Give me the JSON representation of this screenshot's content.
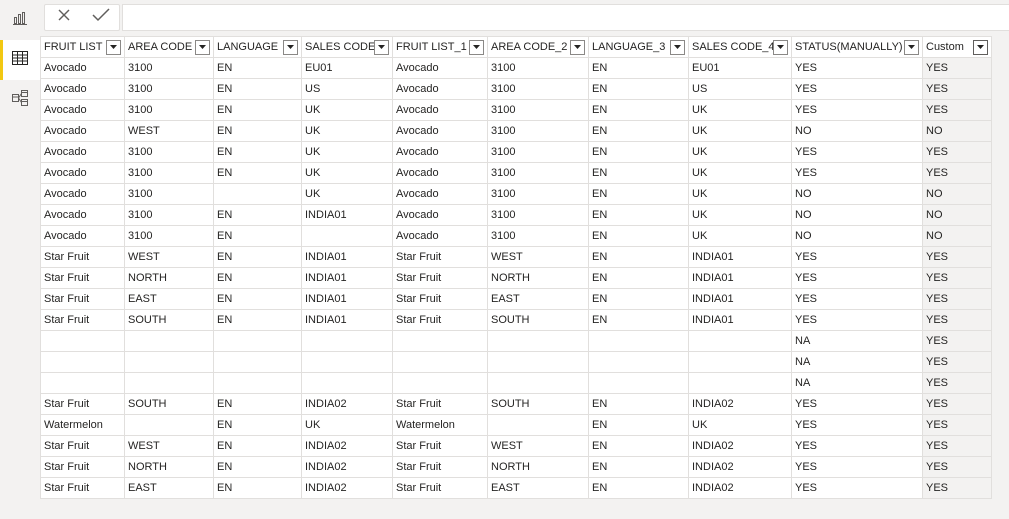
{
  "nav": {
    "items": [
      {
        "name": "report-view-button",
        "icon": "bar-chart-icon"
      },
      {
        "name": "data-view-button",
        "icon": "table-grid-icon"
      },
      {
        "name": "model-view-button",
        "icon": "model-diagram-icon"
      }
    ],
    "active_index": 1,
    "accent_color": "#f2c811"
  },
  "formula": {
    "cancel_icon": "close-icon",
    "commit_icon": "checkmark-icon",
    "value": ""
  },
  "table": {
    "columns": [
      {
        "label": "FRUIT LIST",
        "width": 84
      },
      {
        "label": "AREA CODE",
        "width": 89
      },
      {
        "label": "LANGUAGE",
        "width": 88
      },
      {
        "label": "SALES CODE",
        "width": 91
      },
      {
        "label": "FRUIT LIST_1",
        "width": 95
      },
      {
        "label": "AREA CODE_2",
        "width": 101
      },
      {
        "label": "LANGUAGE_3",
        "width": 100
      },
      {
        "label": "SALES CODE_4",
        "width": 103
      },
      {
        "label": "STATUS(MANUALLY)",
        "width": 131
      },
      {
        "label": "Custom",
        "width": 69,
        "highlight": true
      }
    ],
    "highlight_color": "#c8a227",
    "rows": [
      [
        "Avocado",
        "3100",
        "EN",
        "EU01",
        "Avocado",
        "3100",
        "EN",
        "EU01",
        "YES",
        "YES"
      ],
      [
        "Avocado",
        "3100",
        "EN",
        "US",
        "Avocado",
        "3100",
        "EN",
        "US",
        "YES",
        "YES"
      ],
      [
        "Avocado",
        "3100",
        "EN",
        "UK",
        "Avocado",
        "3100",
        "EN",
        "UK",
        "YES",
        "YES"
      ],
      [
        "Avocado",
        "WEST",
        "EN",
        "UK",
        "Avocado",
        "3100",
        "EN",
        "UK",
        "NO",
        "NO"
      ],
      [
        "Avocado",
        "3100",
        "EN",
        "UK",
        "Avocado",
        "3100",
        "EN",
        "UK",
        "YES",
        "YES"
      ],
      [
        "Avocado",
        "3100",
        "EN",
        "UK",
        "Avocado",
        "3100",
        "EN",
        "UK",
        "YES",
        "YES"
      ],
      [
        "Avocado",
        "3100",
        "",
        "UK",
        "Avocado",
        "3100",
        "EN",
        "UK",
        "NO",
        "NO"
      ],
      [
        "Avocado",
        "3100",
        "EN",
        "INDIA01",
        "Avocado",
        "3100",
        "EN",
        "UK",
        "NO",
        "NO"
      ],
      [
        "Avocado",
        "3100",
        "EN",
        "",
        "Avocado",
        "3100",
        "EN",
        "UK",
        "NO",
        "NO"
      ],
      [
        "Star Fruit",
        "WEST",
        "EN",
        "INDIA01",
        "Star Fruit",
        "WEST",
        "EN",
        "INDIA01",
        "YES",
        "YES"
      ],
      [
        "Star Fruit",
        "NORTH",
        "EN",
        "INDIA01",
        "Star Fruit",
        "NORTH",
        "EN",
        "INDIA01",
        "YES",
        "YES"
      ],
      [
        "Star Fruit",
        "EAST",
        "EN",
        "INDIA01",
        "Star Fruit",
        "EAST",
        "EN",
        "INDIA01",
        "YES",
        "YES"
      ],
      [
        "Star Fruit",
        "SOUTH",
        "EN",
        "INDIA01",
        "Star Fruit",
        "SOUTH",
        "EN",
        "INDIA01",
        "YES",
        "YES"
      ],
      [
        "",
        "",
        "",
        "",
        "",
        "",
        "",
        "",
        "NA",
        "YES"
      ],
      [
        "",
        "",
        "",
        "",
        "",
        "",
        "",
        "",
        "NA",
        "YES"
      ],
      [
        "",
        "",
        "",
        "",
        "",
        "",
        "",
        "",
        "NA",
        "YES"
      ],
      [
        "Star Fruit",
        "SOUTH",
        "EN",
        "INDIA02",
        "Star Fruit",
        "SOUTH",
        "EN",
        "INDIA02",
        "YES",
        "YES"
      ],
      [
        "Watermelon",
        "",
        "EN",
        "UK",
        "Watermelon",
        "",
        "EN",
        "UK",
        "YES",
        "YES"
      ],
      [
        "Star Fruit",
        "WEST",
        "EN",
        "INDIA02",
        "Star Fruit",
        "WEST",
        "EN",
        "INDIA02",
        "YES",
        "YES"
      ],
      [
        "Star Fruit",
        "NORTH",
        "EN",
        "INDIA02",
        "Star Fruit",
        "NORTH",
        "EN",
        "INDIA02",
        "YES",
        "YES"
      ],
      [
        "Star Fruit",
        "EAST",
        "EN",
        "INDIA02",
        "Star Fruit",
        "EAST",
        "EN",
        "INDIA02",
        "YES",
        "YES"
      ]
    ]
  }
}
